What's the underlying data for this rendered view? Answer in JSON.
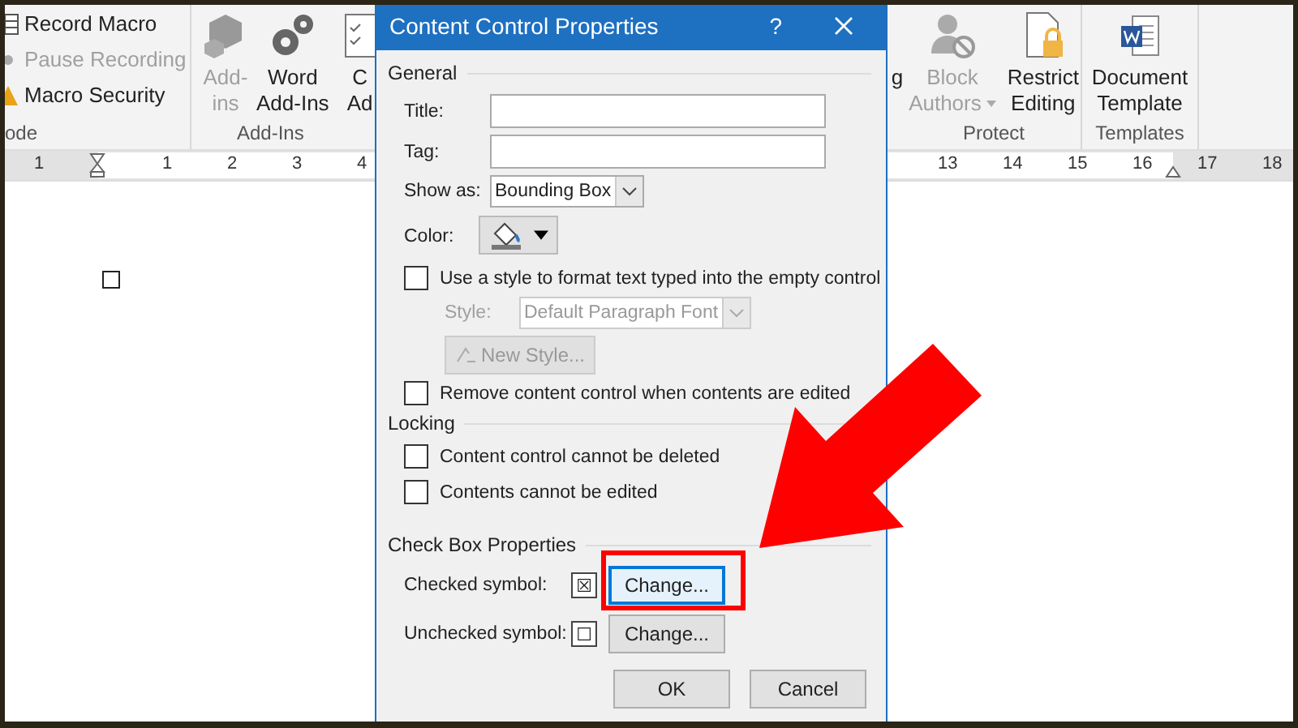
{
  "ribbon": {
    "left_groups": [
      {
        "label": "ode",
        "kind": "small",
        "commands": [
          {
            "label": "Record Macro",
            "disabled": false
          },
          {
            "label": "Pause Recording",
            "disabled": true
          },
          {
            "label": "Macro Security",
            "disabled": false
          }
        ]
      },
      {
        "label": "Add-Ins",
        "kind": "large",
        "commands": [
          {
            "lines": [
              "Add-",
              "ins"
            ],
            "disabled": true
          },
          {
            "lines": [
              "Word",
              "Add-Ins"
            ],
            "disabled": false
          },
          {
            "lines": [
              "C",
              "Ad"
            ],
            "disabled": false
          }
        ]
      }
    ],
    "right_groups": [
      {
        "kind": "large",
        "commands": [
          {
            "lines": [
              "g"
            ],
            "disabled": false
          }
        ]
      },
      {
        "label": "Protect",
        "kind": "large",
        "commands": [
          {
            "lines": [
              "Block",
              "Authors"
            ],
            "disabled": true,
            "dropdown": true
          },
          {
            "lines": [
              "Restrict",
              "Editing"
            ],
            "disabled": false
          }
        ]
      },
      {
        "label": "Templates",
        "kind": "large",
        "commands": [
          {
            "lines": [
              "Document",
              "Template"
            ],
            "disabled": false
          }
        ]
      }
    ]
  },
  "ruler": {
    "left_labels": [
      "1",
      "1",
      "2",
      "3",
      "4"
    ],
    "right_labels": [
      "13",
      "14",
      "15",
      "16",
      "17",
      "18"
    ]
  },
  "document": {
    "checkbox_checked": false
  },
  "dialog": {
    "title": "Content Control Properties",
    "help": "?",
    "general": {
      "heading": "General",
      "title_label": "Title:",
      "tag_label": "Tag:",
      "show_as_label": "Show as:",
      "show_as_value": "Bounding Box",
      "color_label": "Color:",
      "use_style": {
        "label": "Use a style to format text typed into the empty control",
        "checked": false
      },
      "style_label": "Style:",
      "style_value": "Default Paragraph Font",
      "new_style": "New Style...",
      "remove": {
        "label": "Remove content control when contents are edited",
        "checked": false
      }
    },
    "locking": {
      "heading": "Locking",
      "options": [
        {
          "label": "Content control cannot be deleted",
          "checked": false
        },
        {
          "label": "Contents cannot be edited",
          "checked": false
        }
      ]
    },
    "checkbox_properties": {
      "heading": "Check Box Properties",
      "rows": [
        {
          "label": "Checked symbol:",
          "symbol": "☒",
          "button": "Change...",
          "focused": true
        },
        {
          "label": "Unchecked symbol:",
          "symbol": "☐",
          "button": "Change...",
          "focused": false
        }
      ]
    },
    "buttons": [
      "OK",
      "Cancel"
    ]
  }
}
